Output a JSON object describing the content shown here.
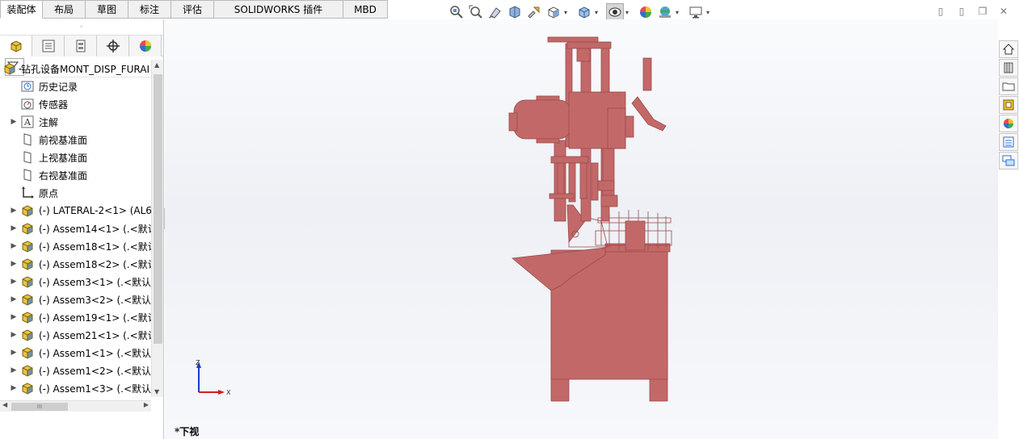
{
  "tabs": [
    {
      "label": "装配体",
      "active": true
    },
    {
      "label": "布局"
    },
    {
      "label": "草图"
    },
    {
      "label": "标注"
    },
    {
      "label": "评估"
    },
    {
      "label": "SOLIDWORKS 插件"
    },
    {
      "label": "MBD"
    }
  ],
  "heads_up_toolbar": {
    "icons": [
      "zoom-to-fit-icon",
      "zoom-to-area-icon",
      "previous-view-icon",
      "section-view-icon",
      "dynamic-annotation-icon",
      "view-orientation-icon",
      "display-style-icon",
      "hide-show-items-icon",
      "edit-appearance-icon",
      "apply-scene-icon",
      "view-settings-icon"
    ]
  },
  "window_controls": [
    "restore-left-icon",
    "restore-right-icon",
    "restore-icon",
    "close-icon"
  ],
  "feature_tree": {
    "root": {
      "label": "钻孔设备MONT_DISP_FURAI",
      "icon": "assembly-icon"
    },
    "items": [
      {
        "label": "历史记录",
        "icon": "history-icon",
        "expandable": false
      },
      {
        "label": "传感器",
        "icon": "sensor-icon",
        "expandable": false
      },
      {
        "label": "注解",
        "icon": "annotation-icon",
        "expandable": true
      },
      {
        "label": "前视基准面",
        "icon": "plane-icon",
        "expandable": false
      },
      {
        "label": "上视基准面",
        "icon": "plane-icon",
        "expandable": false
      },
      {
        "label": "右视基准面",
        "icon": "plane-icon",
        "expandable": false
      },
      {
        "label": "原点",
        "icon": "origin-icon",
        "expandable": false
      },
      {
        "label": "(-) LATERAL-2<1> (AL6(",
        "icon": "subassembly-icon",
        "expandable": true
      },
      {
        "label": "(-) Assem14<1> (.<默认",
        "icon": "subassembly-icon",
        "expandable": true
      },
      {
        "label": "(-) Assem18<1> (.<默认",
        "icon": "subassembly-icon",
        "expandable": true
      },
      {
        "label": "(-) Assem18<2> (.<默认",
        "icon": "subassembly-icon",
        "expandable": true
      },
      {
        "label": "(-) Assem3<1> (.<默认_",
        "icon": "subassembly-icon",
        "expandable": true
      },
      {
        "label": "(-) Assem3<2> (.<默认_",
        "icon": "subassembly-icon",
        "expandable": true
      },
      {
        "label": "(-) Assem19<1> (.<默认",
        "icon": "subassembly-icon",
        "expandable": true
      },
      {
        "label": "(-) Assem21<1> (.<默认",
        "icon": "subassembly-icon",
        "expandable": true
      },
      {
        "label": "(-) Assem1<1> (.<默认_",
        "icon": "subassembly-icon",
        "expandable": true
      },
      {
        "label": "(-) Assem1<2> (.<默认_",
        "icon": "subassembly-icon",
        "expandable": true
      },
      {
        "label": "(-) Assem1<3> (.<默认_",
        "icon": "subassembly-icon",
        "expandable": true
      }
    ]
  },
  "panel_tabs": [
    "featuremanager-tab-icon",
    "propertymanager-tab-icon",
    "configurationmanager-tab-icon",
    "dimxpertmanager-tab-icon",
    "displaymanager-tab-icon"
  ],
  "viewport": {
    "view_name": "*下视",
    "model_color": "#c06464",
    "triad": {
      "x_label": "X",
      "z_label": "Z"
    }
  },
  "task_pane": [
    "home-icon",
    "design-library-icon",
    "file-explorer-icon",
    "view-palette-icon",
    "appearances-icon",
    "custom-properties-icon",
    "forum-icon"
  ],
  "colors": {
    "model": "#c36868",
    "model_dark": "#9a4a4a",
    "triad_x": "#d21e1e",
    "triad_z": "#1e3cc8"
  }
}
